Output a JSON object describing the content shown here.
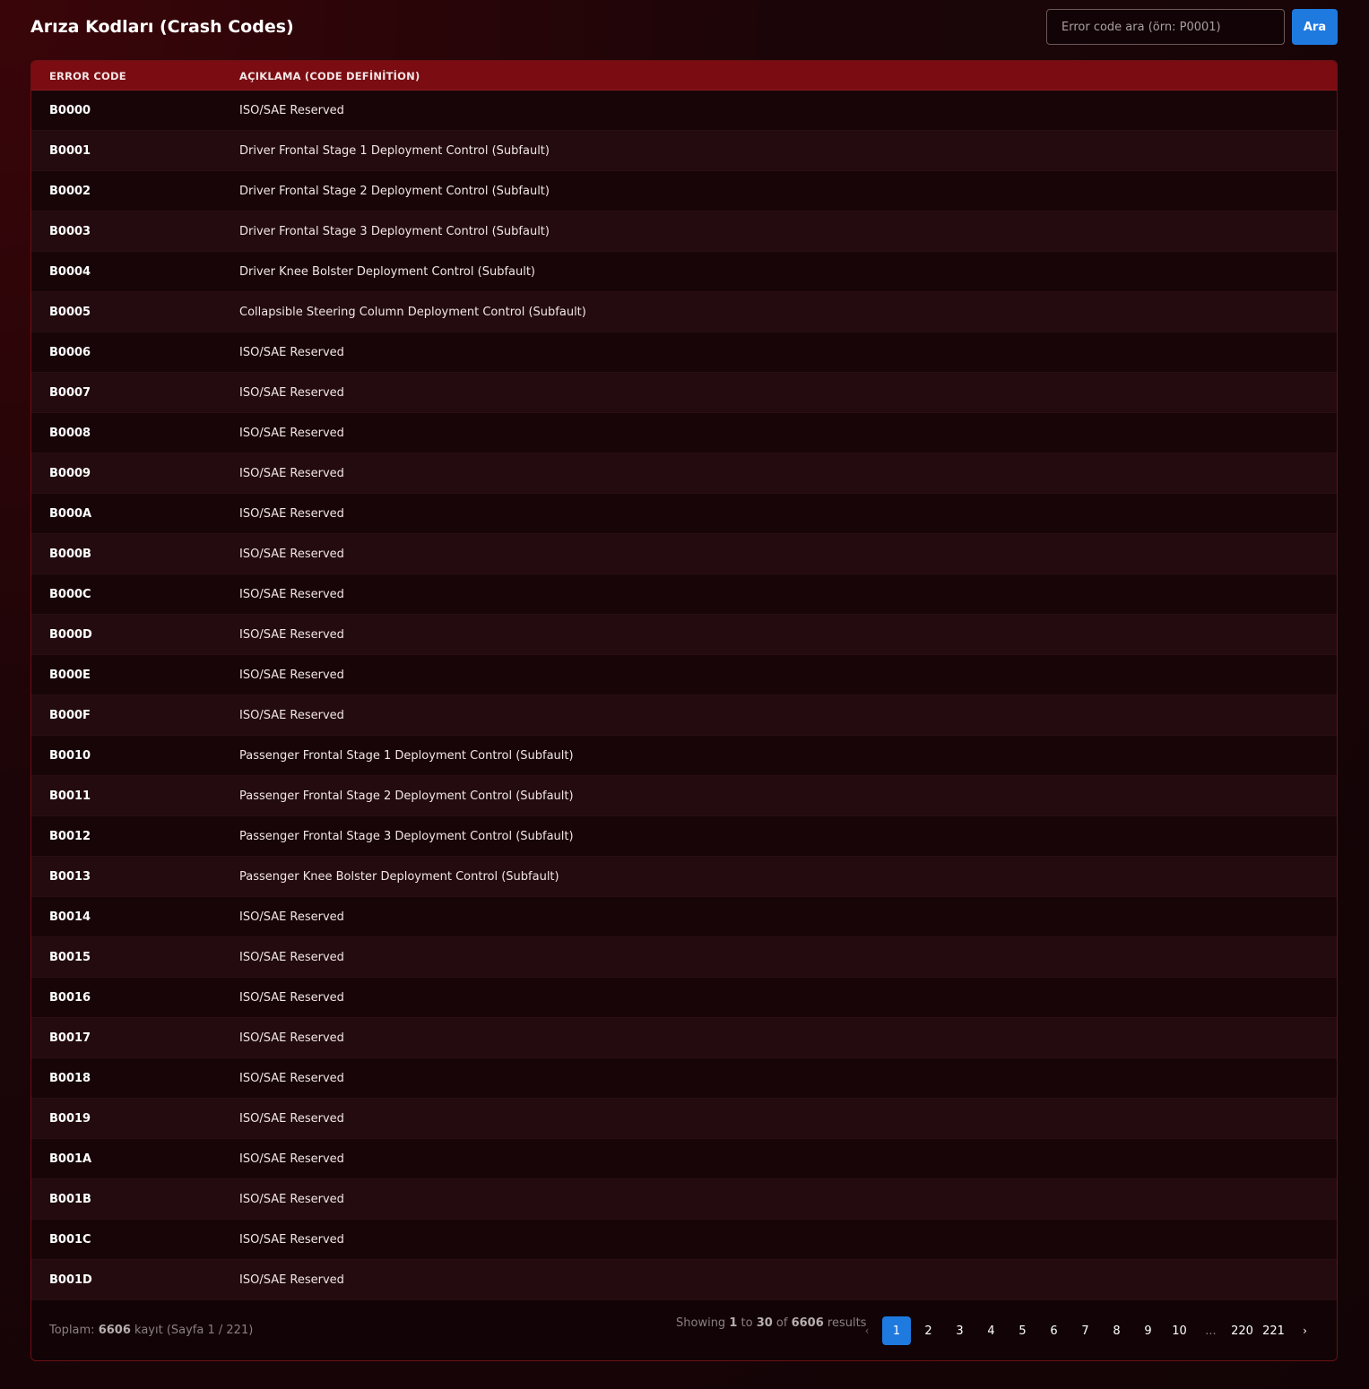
{
  "header": {
    "title": "Arıza Kodları (Crash Codes)",
    "search_placeholder": "Error code ara (örn: P0001)",
    "search_button": "Ara"
  },
  "table": {
    "columns": [
      "ERROR CODE",
      "AÇIKLAMA (CODE DEFİNİTİON)"
    ],
    "rows": [
      {
        "code": "B0000",
        "desc": "ISO/SAE Reserved"
      },
      {
        "code": "B0001",
        "desc": "Driver Frontal Stage 1 Deployment Control (Subfault)"
      },
      {
        "code": "B0002",
        "desc": "Driver Frontal Stage 2 Deployment Control (Subfault)"
      },
      {
        "code": "B0003",
        "desc": "Driver Frontal Stage 3 Deployment Control (Subfault)"
      },
      {
        "code": "B0004",
        "desc": "Driver Knee Bolster Deployment Control (Subfault)"
      },
      {
        "code": "B0005",
        "desc": "Collapsible Steering Column Deployment Control (Subfault)"
      },
      {
        "code": "B0006",
        "desc": "ISO/SAE Reserved"
      },
      {
        "code": "B0007",
        "desc": "ISO/SAE Reserved"
      },
      {
        "code": "B0008",
        "desc": "ISO/SAE Reserved"
      },
      {
        "code": "B0009",
        "desc": "ISO/SAE Reserved"
      },
      {
        "code": "B000A",
        "desc": "ISO/SAE Reserved"
      },
      {
        "code": "B000B",
        "desc": "ISO/SAE Reserved"
      },
      {
        "code": "B000C",
        "desc": "ISO/SAE Reserved"
      },
      {
        "code": "B000D",
        "desc": "ISO/SAE Reserved"
      },
      {
        "code": "B000E",
        "desc": "ISO/SAE Reserved"
      },
      {
        "code": "B000F",
        "desc": "ISO/SAE Reserved"
      },
      {
        "code": "B0010",
        "desc": "Passenger Frontal Stage 1 Deployment Control (Subfault)"
      },
      {
        "code": "B0011",
        "desc": "Passenger Frontal Stage 2 Deployment Control (Subfault)"
      },
      {
        "code": "B0012",
        "desc": "Passenger Frontal Stage 3 Deployment Control (Subfault)"
      },
      {
        "code": "B0013",
        "desc": "Passenger Knee Bolster Deployment Control (Subfault)"
      },
      {
        "code": "B0014",
        "desc": "ISO/SAE Reserved"
      },
      {
        "code": "B0015",
        "desc": "ISO/SAE Reserved"
      },
      {
        "code": "B0016",
        "desc": "ISO/SAE Reserved"
      },
      {
        "code": "B0017",
        "desc": "ISO/SAE Reserved"
      },
      {
        "code": "B0018",
        "desc": "ISO/SAE Reserved"
      },
      {
        "code": "B0019",
        "desc": "ISO/SAE Reserved"
      },
      {
        "code": "B001A",
        "desc": "ISO/SAE Reserved"
      },
      {
        "code": "B001B",
        "desc": "ISO/SAE Reserved"
      },
      {
        "code": "B001C",
        "desc": "ISO/SAE Reserved"
      },
      {
        "code": "B001D",
        "desc": "ISO/SAE Reserved"
      }
    ]
  },
  "footer": {
    "total_prefix": "Toplam: ",
    "total_count": "6606",
    "total_suffix": " kayıt (Sayfa 1 / 221)",
    "showing_prefix": "Showing ",
    "showing_from": "1",
    "showing_to_word": " to ",
    "showing_to": "30",
    "showing_of_word": " of ",
    "showing_total": "6606",
    "showing_suffix": " results"
  },
  "pagination": {
    "prev": "‹",
    "next": "›",
    "pages": [
      "1",
      "2",
      "3",
      "4",
      "5",
      "6",
      "7",
      "8",
      "9",
      "10",
      "...",
      "220",
      "221"
    ],
    "active": "1"
  },
  "colors": {
    "accent": "#1f7ae0",
    "header_bg": "#7a0c12"
  }
}
